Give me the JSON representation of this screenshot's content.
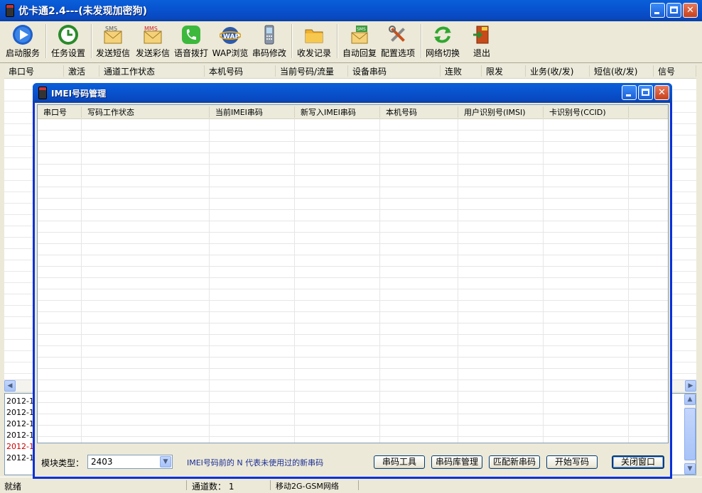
{
  "main_window": {
    "title": "优卡通2.4---(未发现加密狗)",
    "toolbar": [
      {
        "label": "启动服务",
        "icon": "play-icon"
      },
      {
        "label": "任务设置",
        "icon": "task-settings-icon"
      },
      {
        "label": "发送短信",
        "icon": "sms-icon"
      },
      {
        "label": "发送彩信",
        "icon": "mms-icon"
      },
      {
        "label": "语音拨打",
        "icon": "phone-icon"
      },
      {
        "label": "WAP浏览",
        "icon": "wap-icon"
      },
      {
        "label": "串码修改",
        "icon": "mobile-icon"
      },
      {
        "label": "收发记录",
        "icon": "folder-icon"
      },
      {
        "label": "自动回复",
        "icon": "auto-reply-icon"
      },
      {
        "label": "配置选项",
        "icon": "tools-icon"
      },
      {
        "label": "网络切换",
        "icon": "refresh-icon"
      },
      {
        "label": "退出",
        "icon": "exit-icon"
      }
    ],
    "columns": [
      "串口号",
      "激活",
      "通道工作状态",
      "本机号码",
      "当前号码/流量",
      "设备串码",
      "连败",
      "限发",
      "业务(收/发)",
      "短信(收/发)",
      "信号"
    ],
    "log_lines": [
      "2012-1",
      "2012-1",
      "2012-1",
      "2012-1",
      "2012-1",
      "2012-1"
    ],
    "status": {
      "ready": "就绪",
      "channels": "通道数： 1",
      "network": "移动2G-GSM网络"
    }
  },
  "dialog": {
    "title": "IMEI号码管理",
    "columns": [
      "串口号",
      "写码工作状态",
      "当前IMEI串码",
      "新写入IMEI串码",
      "本机号码",
      "用户识别号(IMSI)",
      "卡识别号(CCID)"
    ],
    "module_label": "模块类型：",
    "module_value": "2403",
    "hint": "IMEI号码前的 N 代表未使用过的新串码",
    "buttons": {
      "tools": "串码工具",
      "library": "串码库管理",
      "match": "匹配新串码",
      "start": "开始写码",
      "close": "关闭窗口"
    }
  },
  "colors": {
    "title_blue": "#0854d0",
    "log_red": "#cc0000"
  }
}
